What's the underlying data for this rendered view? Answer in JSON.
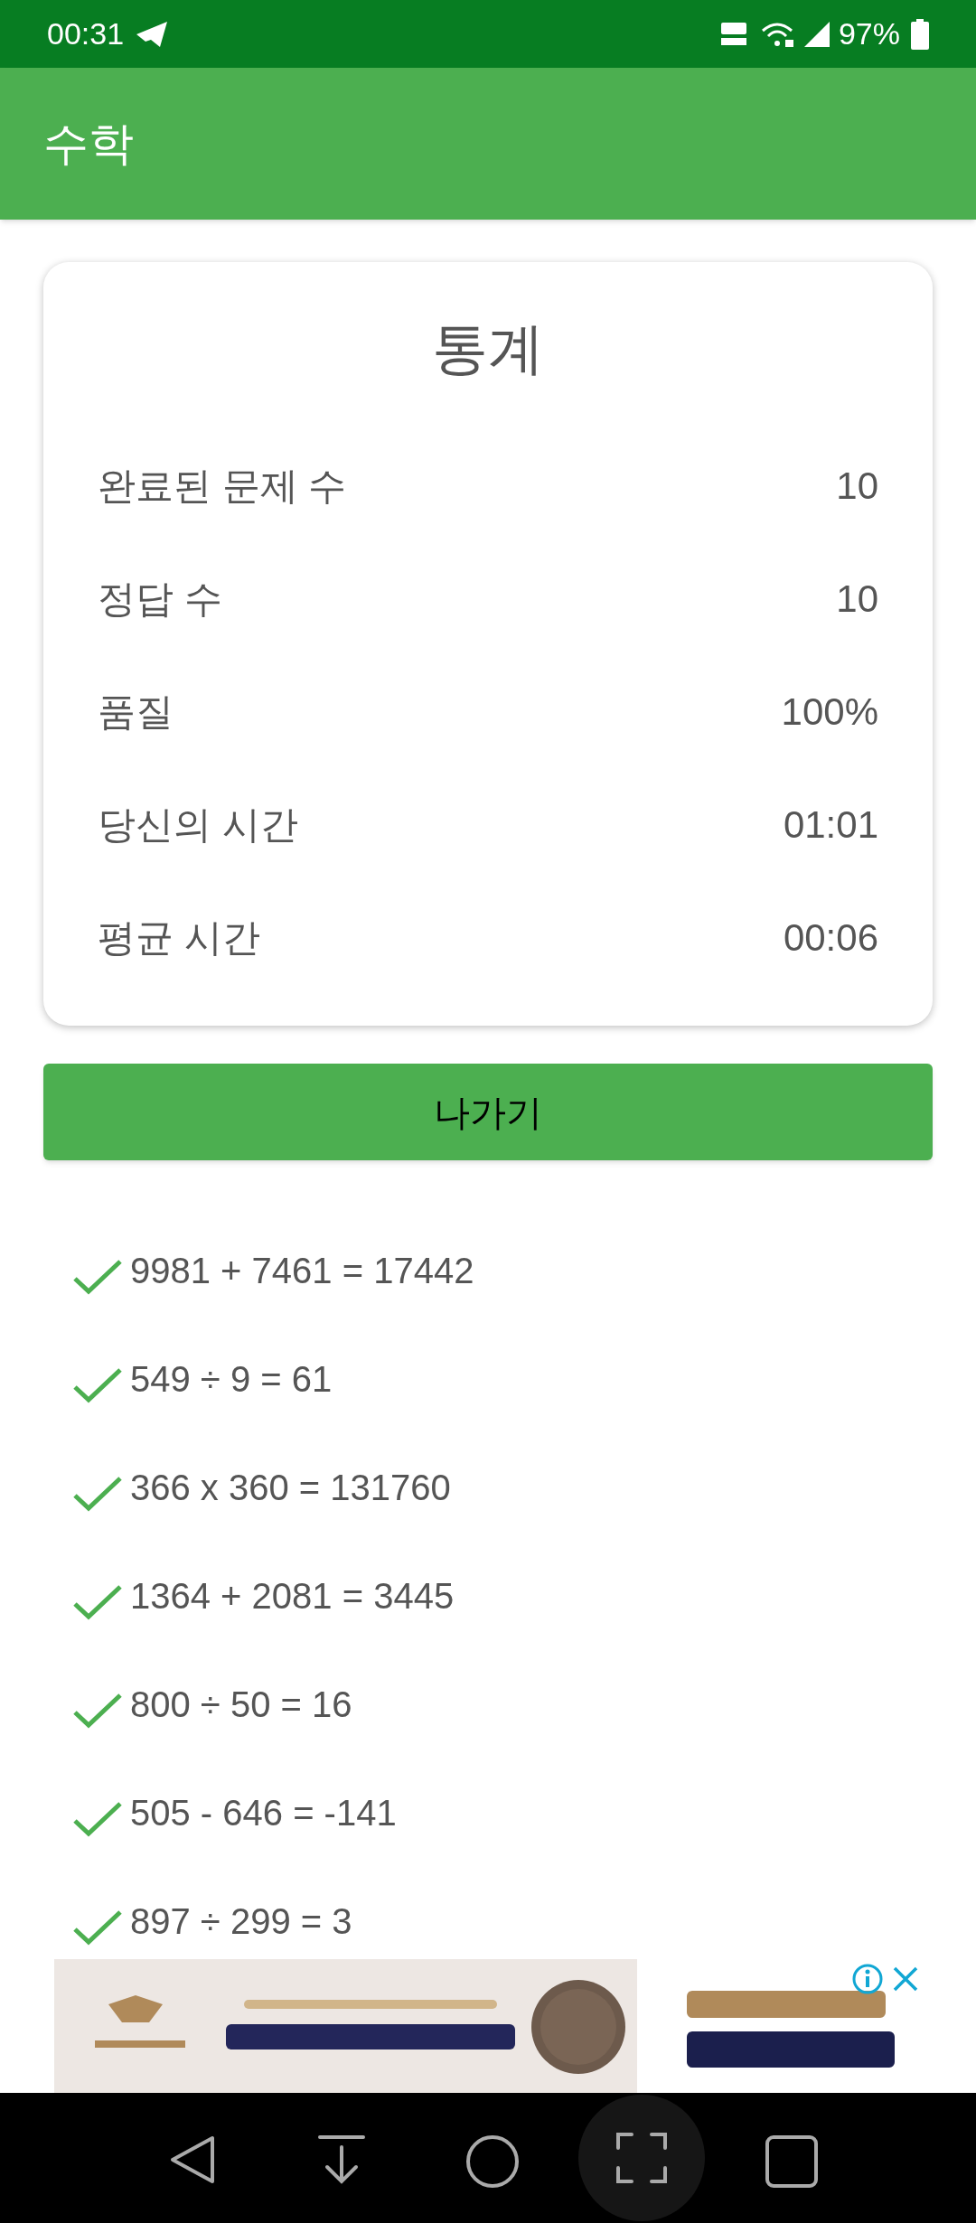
{
  "status_bar": {
    "time": "00:31",
    "battery": "97%"
  },
  "app_bar": {
    "title": "수학"
  },
  "stats": {
    "title": "통계",
    "rows": [
      {
        "label": "완료된 문제 수",
        "value": "10"
      },
      {
        "label": "정답 수",
        "value": "10"
      },
      {
        "label": "품질",
        "value": "100%"
      },
      {
        "label": "당신의 시간",
        "value": "01:01"
      },
      {
        "label": "평균 시간",
        "value": "00:06"
      }
    ]
  },
  "exit_button": "나가기",
  "results": [
    {
      "text": "9981 + 7461 = 17442",
      "correct": true
    },
    {
      "text": "549 ÷ 9 = 61",
      "correct": true
    },
    {
      "text": "366 x 360 = 131760",
      "correct": true
    },
    {
      "text": "1364 + 2081 = 3445",
      "correct": true
    },
    {
      "text": "800 ÷ 50 = 16",
      "correct": true
    },
    {
      "text": "505 - 646 = -141",
      "correct": true
    },
    {
      "text": "897 ÷ 299 = 3",
      "correct": true
    }
  ]
}
